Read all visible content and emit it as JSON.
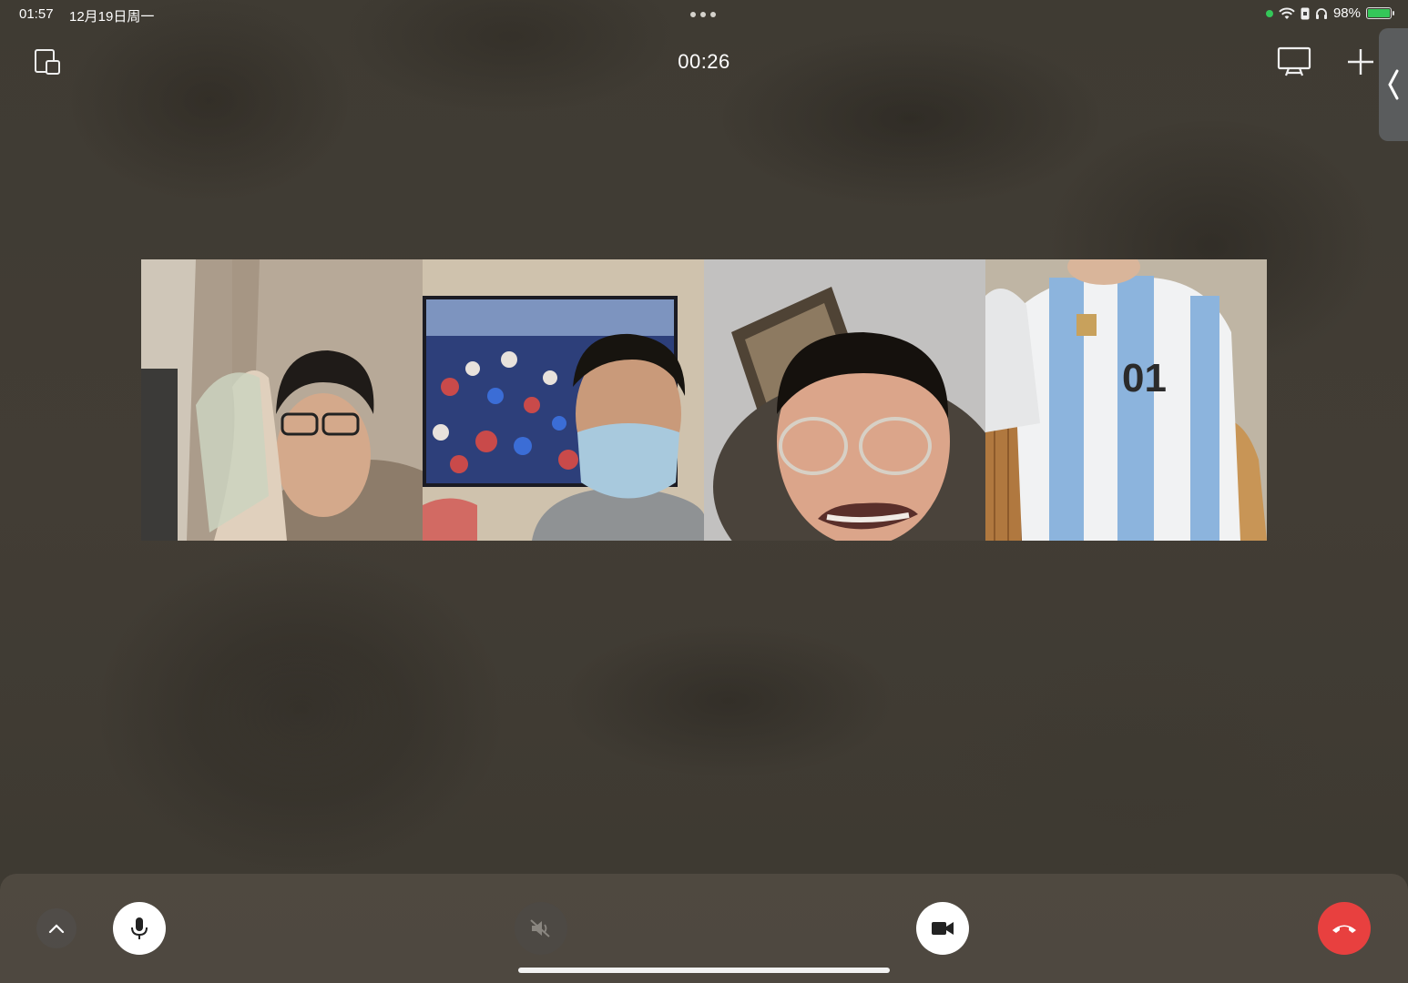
{
  "status_bar": {
    "time": "01:57",
    "date": "12月19日周一",
    "battery": "98%"
  },
  "call": {
    "duration": "00:26",
    "participants": [
      {
        "id": "p1",
        "camera": "on"
      },
      {
        "id": "p2",
        "camera": "on"
      },
      {
        "id": "p3",
        "camera": "on"
      },
      {
        "id": "p4",
        "camera": "on"
      }
    ]
  },
  "controls": {
    "collapse": "chevron-up-icon",
    "microphone": "microphone-icon",
    "speaker": "speaker-muted-icon",
    "camera": "video-camera-icon",
    "hangup": "phone-hangup-icon"
  },
  "colors": {
    "hangup": "#e8403f",
    "accent_green": "#34c759",
    "background": "#3e3a33"
  }
}
